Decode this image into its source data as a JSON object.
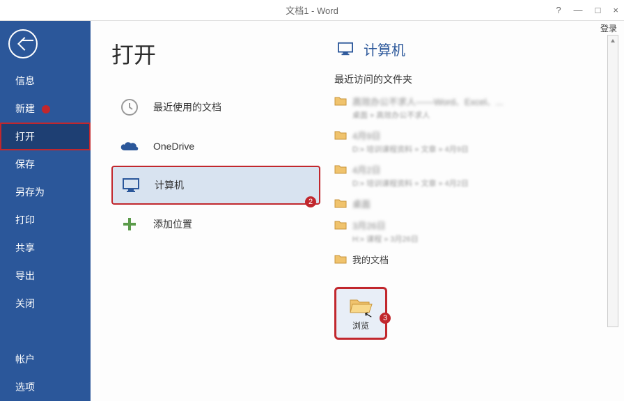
{
  "titlebar": {
    "title": "文档1 - Word",
    "help": "?",
    "min": "—",
    "restore": "□",
    "close": "×",
    "login": "登录"
  },
  "sidebar": {
    "items": [
      "信息",
      "新建",
      "打开",
      "保存",
      "另存为",
      "打印",
      "共享",
      "导出",
      "关闭"
    ],
    "bottom": [
      "帐户",
      "选项"
    ]
  },
  "page": {
    "title": "打开"
  },
  "locations": {
    "recent": "最近使用的文档",
    "onedrive": "OneDrive",
    "computer": "计算机",
    "add": "添加位置"
  },
  "rightPanel": {
    "title": "计算机",
    "recentFoldersLabel": "最近访问的文件夹",
    "folders": [
      {
        "name": "高效办公不求人——Word、Excel、...",
        "path": "桌面 » 高效办公不求人"
      },
      {
        "name": "4月9日",
        "path": "D:» 培训课程资料 » 文章 » 4月9日"
      },
      {
        "name": "4月2日",
        "path": "D:» 培训课程资料 » 文章 » 4月2日"
      },
      {
        "name": "桌面",
        "path": ""
      },
      {
        "name": "3月26日",
        "path": "H:» 课程 » 3月26日"
      },
      {
        "name": "我的文档",
        "path": ""
      }
    ],
    "browse": "浏览"
  },
  "annotations": {
    "badge2": "2",
    "badge3": "3"
  }
}
